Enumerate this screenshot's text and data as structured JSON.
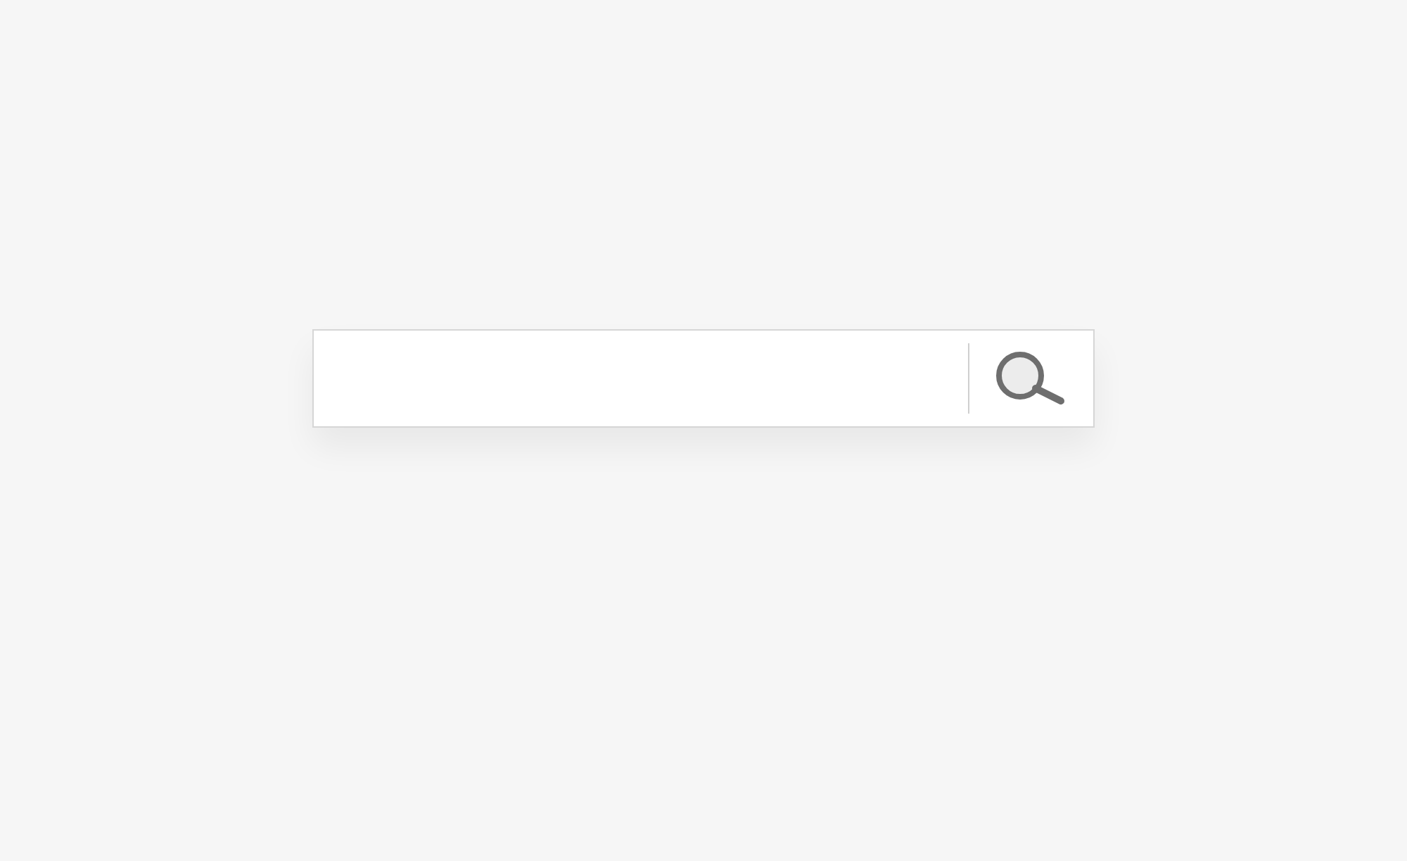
{
  "search_bar": {
    "button": {
      "kind": "search"
    }
  }
}
